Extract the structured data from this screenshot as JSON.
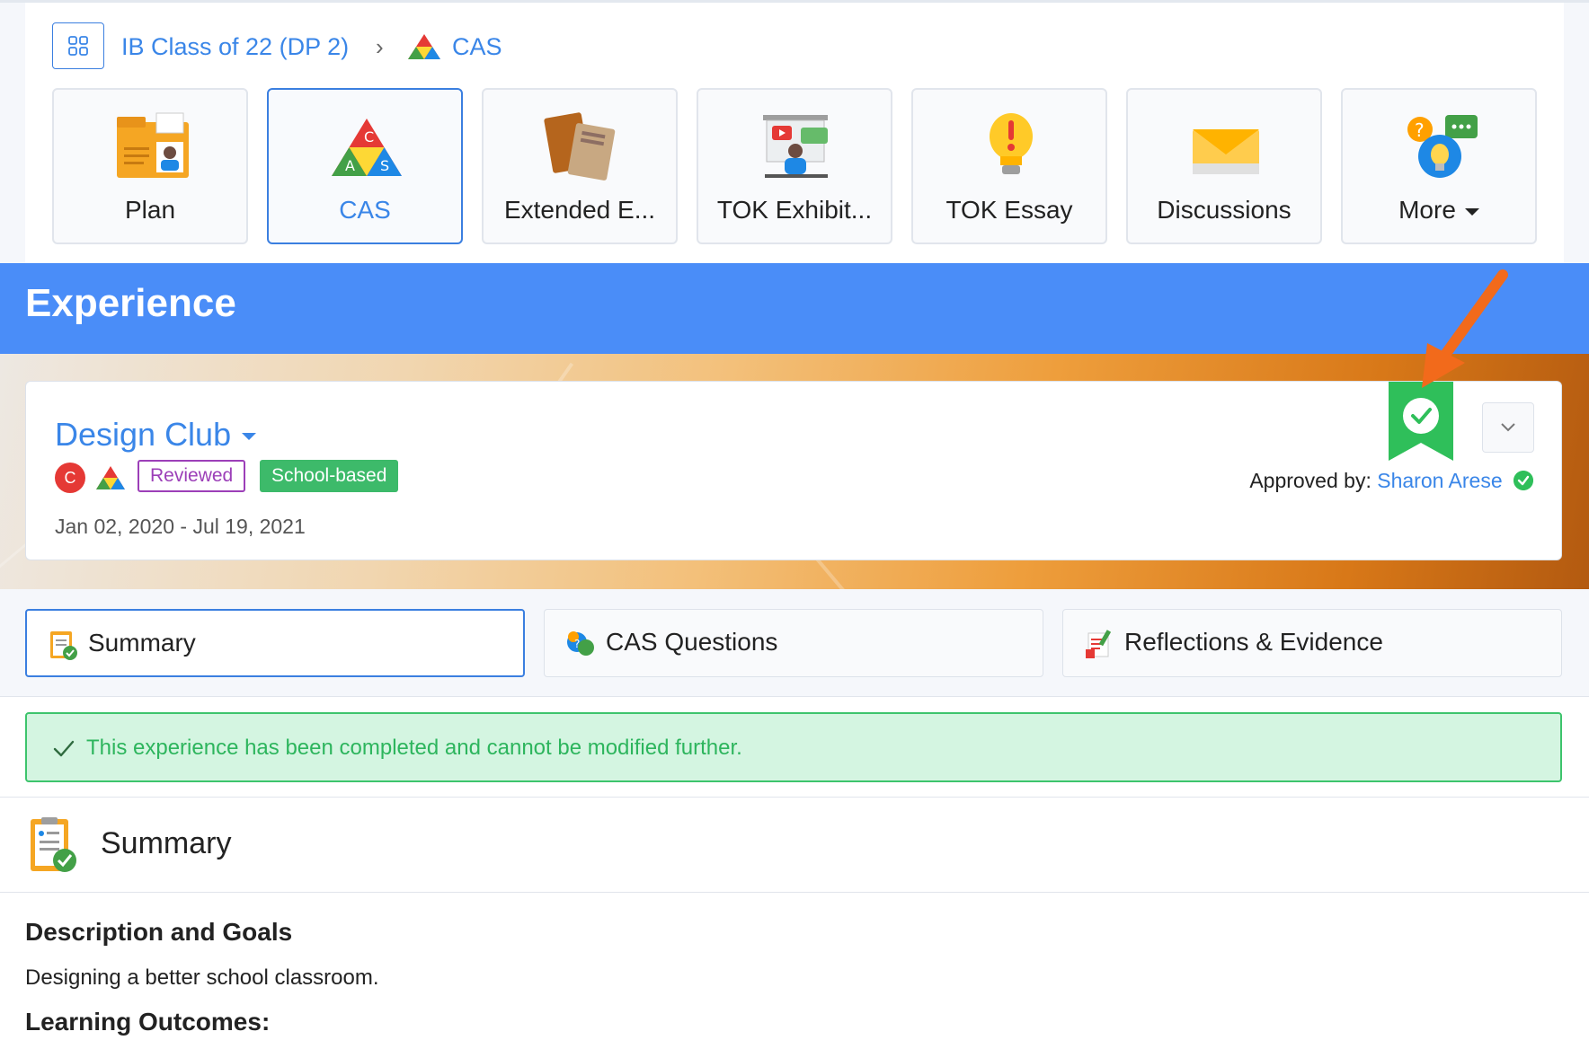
{
  "breadcrumb": {
    "class_name": "IB Class of 22 (DP 2)",
    "separator": "›",
    "current": "CAS"
  },
  "tiles": [
    {
      "label": "Plan",
      "icon": "folder-plan-icon"
    },
    {
      "label": "CAS",
      "icon": "cas-triangle-icon",
      "active": true
    },
    {
      "label": "Extended E...",
      "icon": "books-icon"
    },
    {
      "label": "TOK Exhibit...",
      "icon": "presentation-icon"
    },
    {
      "label": "TOK Essay",
      "icon": "lightbulb-icon"
    },
    {
      "label": "Discussions",
      "icon": "envelope-icon"
    },
    {
      "label": "More",
      "icon": "chat-bubbles-icon"
    }
  ],
  "header": {
    "title": "Experience"
  },
  "experience": {
    "name": "Design Club",
    "avatar_letter": "C",
    "badge_reviewed": "Reviewed",
    "badge_school": "School-based",
    "dates": "Jan 02, 2020 - Jul 19, 2021",
    "approved_label": "Approved by:",
    "approved_name": "Sharon Arese"
  },
  "tabs": [
    {
      "label": "Summary",
      "icon": "clipboard-check-icon",
      "active": true
    },
    {
      "label": "CAS Questions",
      "icon": "question-bubbles-icon"
    },
    {
      "label": "Reflections & Evidence",
      "icon": "notebook-pencil-icon"
    }
  ],
  "alert": {
    "text": "This experience has been completed and cannot be modified further."
  },
  "summary": {
    "title": "Summary",
    "description_heading": "Description and Goals",
    "description_text": "Designing a better school classroom.",
    "learning_heading": "Learning Outcomes:"
  },
  "colors": {
    "accent_blue": "#4a8df8",
    "link_blue": "#3a86e8",
    "success_green": "#3dba6a",
    "reviewed_purple": "#9c3fb8",
    "arrow_orange": "#f26a1b"
  }
}
